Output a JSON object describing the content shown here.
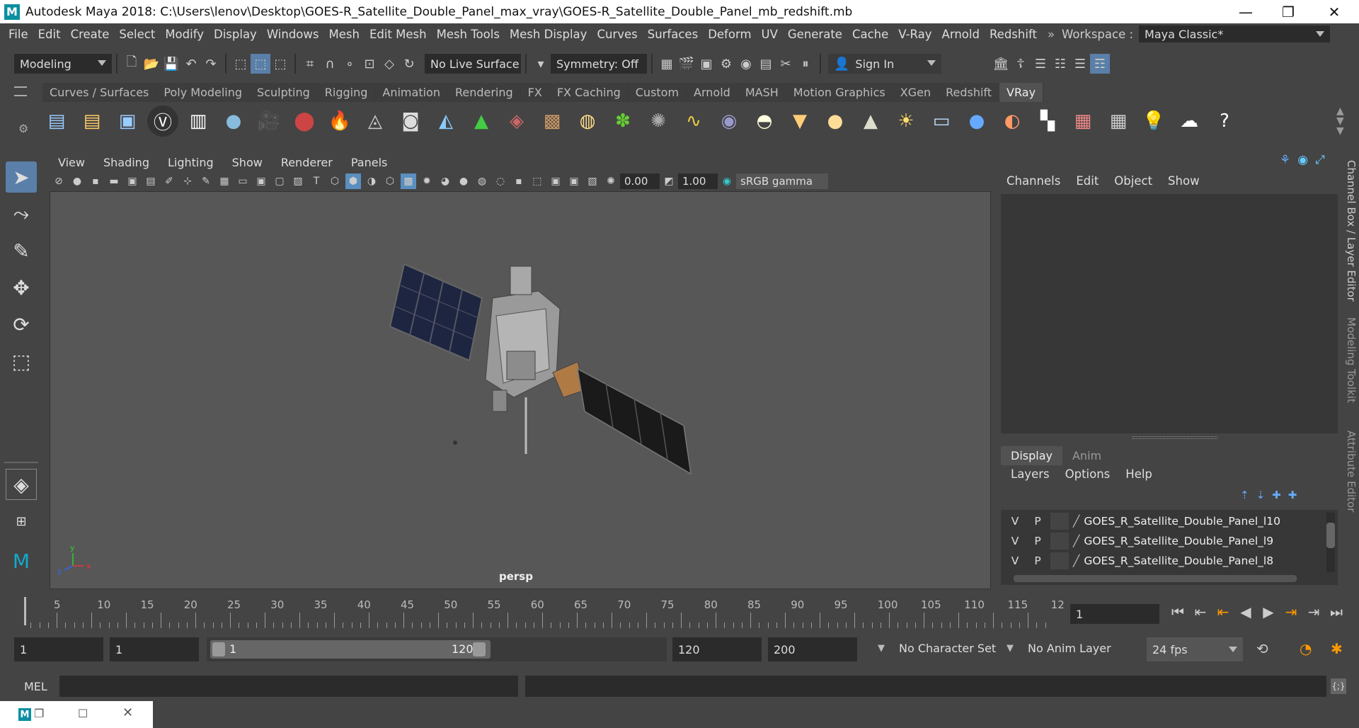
{
  "window": {
    "title": "Autodesk Maya 2018: C:\\Users\\lenov\\Desktop\\GOES-R_Satellite_Double_Panel_max_vray\\GOES-R_Satellite_Double_Panel_mb_redshift.mb",
    "logo": "M"
  },
  "menu": [
    "File",
    "Edit",
    "Create",
    "Select",
    "Modify",
    "Display",
    "Windows",
    "Mesh",
    "Edit Mesh",
    "Mesh Tools",
    "Mesh Display",
    "Curves",
    "Surfaces",
    "Deform",
    "UV",
    "Generate",
    "Cache",
    "V-Ray",
    "Arnold",
    "Redshift"
  ],
  "workspace": {
    "label": "Workspace :",
    "value": "Maya Classic*"
  },
  "status": {
    "mode": "Modeling",
    "live_surface": "No Live Surface",
    "symmetry": "Symmetry: Off",
    "sign_in": "Sign In"
  },
  "shelf_tabs": [
    "Curves / Surfaces",
    "Poly Modeling",
    "Sculpting",
    "Rigging",
    "Animation",
    "Rendering",
    "FX",
    "FX Caching",
    "Custom",
    "Arnold",
    "MASH",
    "Motion Graphics",
    "XGen",
    "Redshift",
    "VRay"
  ],
  "shelf_active": "VRay",
  "viewport": {
    "menu": [
      "View",
      "Shading",
      "Lighting",
      "Show",
      "Renderer",
      "Panels"
    ],
    "exposure": "0.00",
    "gamma": "1.00",
    "color_space": "sRGB gamma",
    "camera": "persp"
  },
  "channel_box": {
    "menu": [
      "Channels",
      "Edit",
      "Object",
      "Show"
    ]
  },
  "layer_editor": {
    "tabs": [
      "Display",
      "Anim"
    ],
    "menu": [
      "Layers",
      "Options",
      "Help"
    ],
    "layers": [
      {
        "v": "V",
        "p": "P",
        "name": "GOES_R_Satellite_Double_Panel_l10"
      },
      {
        "v": "V",
        "p": "P",
        "name": "GOES_R_Satellite_Double_Panel_l9"
      },
      {
        "v": "V",
        "p": "P",
        "name": "GOES_R_Satellite_Double_Panel_l8"
      }
    ]
  },
  "side_tabs": [
    "Channel Box / Layer Editor",
    "Modeling Toolkit",
    "Attribute Editor"
  ],
  "timeline": {
    "ticks": [
      "5",
      "10",
      "15",
      "20",
      "25",
      "30",
      "35",
      "40",
      "45",
      "50",
      "55",
      "60",
      "65",
      "70",
      "75",
      "80",
      "85",
      "90",
      "95",
      "100",
      "105",
      "110",
      "115",
      "12"
    ],
    "start_label": "1",
    "current_frame": "1"
  },
  "range": {
    "start": "1",
    "inner_start": "1",
    "slider_start": "1",
    "slider_end": "120",
    "end": "120",
    "outer_end": "200",
    "character_set": "No Character Set",
    "anim_layer": "No Anim Layer",
    "fps": "24 fps"
  },
  "command": {
    "label": "MEL"
  }
}
